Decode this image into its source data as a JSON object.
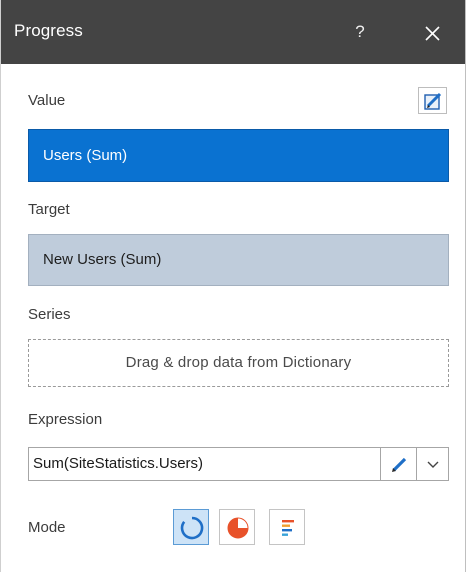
{
  "window": {
    "title": "Progress",
    "help_label": "?",
    "close_icon": "close-icon"
  },
  "value": {
    "label": "Value",
    "field_text": "Users (Sum)",
    "edit_icon": "edit-expression-icon"
  },
  "target": {
    "label": "Target",
    "field_text": "New Users (Sum)"
  },
  "series": {
    "label": "Series",
    "drop_hint": "Drag & drop data from Dictionary"
  },
  "expression": {
    "label": "Expression",
    "value": "Sum(SiteStatistics.Users)",
    "edit_icon": "pencil-icon",
    "dropdown_icon": "chevron-down-icon"
  },
  "mode": {
    "label": "Mode",
    "options": [
      {
        "name": "circle",
        "icon": "ring-progress-icon",
        "selected": true
      },
      {
        "name": "pie",
        "icon": "pie-progress-icon",
        "selected": false
      },
      {
        "name": "bars",
        "icon": "bar-progress-icon",
        "selected": false
      }
    ]
  },
  "colors": {
    "titlebar": "#444444",
    "selected_field": "#0a72d1",
    "target_field": "#bfccdb",
    "accent_blue": "#1f6fc7",
    "pie_orange": "#e8522a"
  }
}
